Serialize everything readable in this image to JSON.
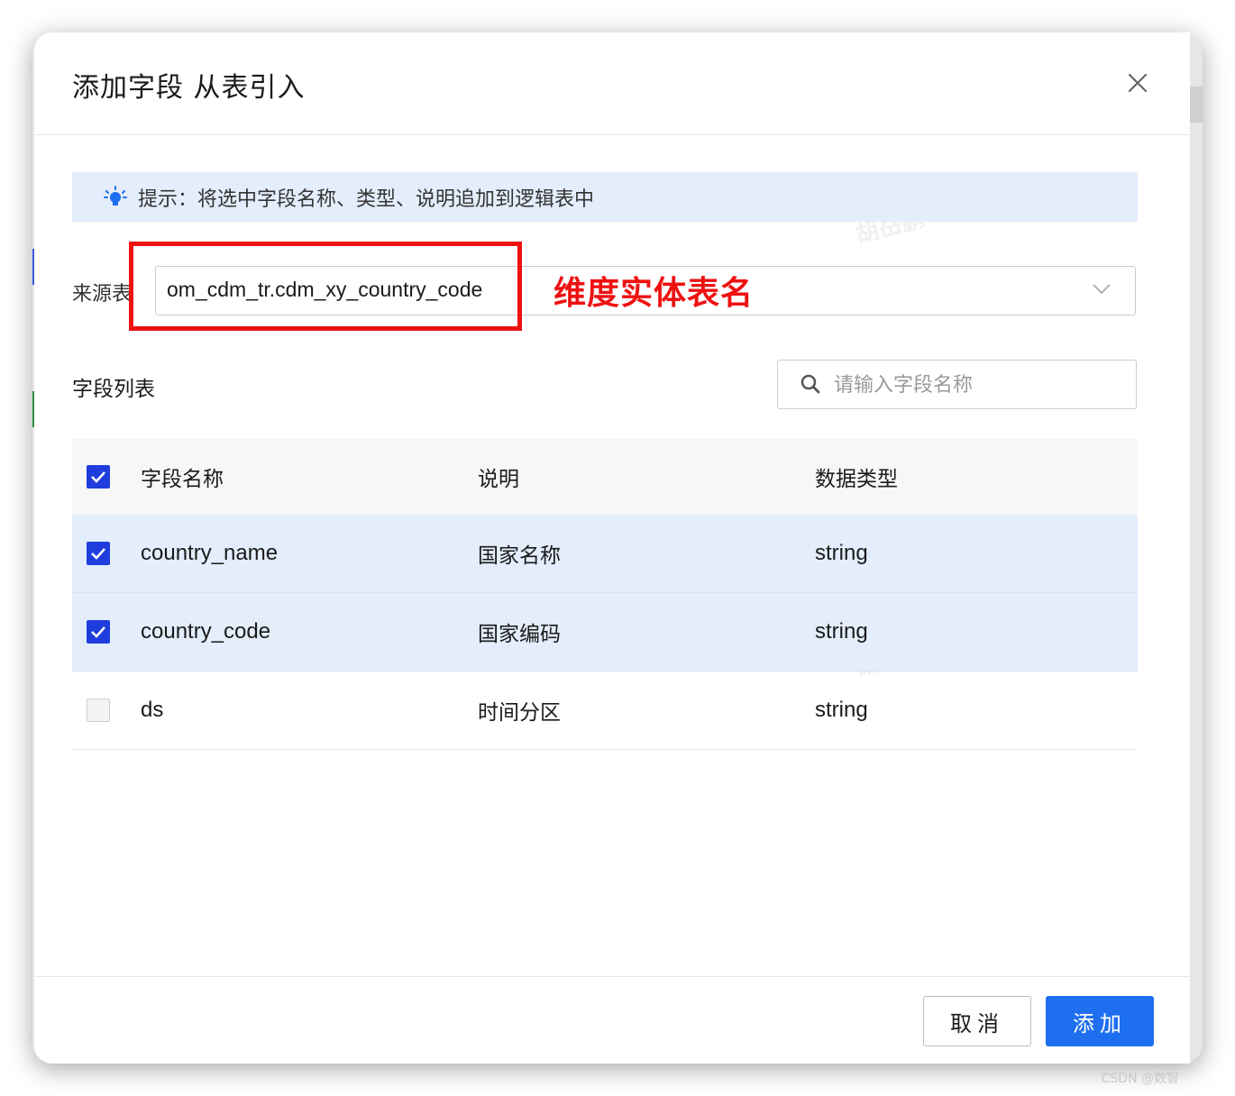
{
  "dialog": {
    "title": "添加字段 从表引入",
    "close_label": "×"
  },
  "tip": {
    "text": "提示：将选中字段名称、类型、说明追加到逻辑表中",
    "icon": "lightbulb-icon"
  },
  "source_table": {
    "label": "来源表",
    "value": "om_cdm_tr.cdm_xy_country_code",
    "annotation": "维度实体表名"
  },
  "field_list": {
    "label": "字段列表",
    "search_placeholder": "请输入字段名称"
  },
  "table": {
    "columns": [
      "字段名称",
      "说明",
      "数据类型"
    ],
    "header_checked": true,
    "rows": [
      {
        "name": "country_name",
        "desc": "国家名称",
        "type": "string",
        "checked": true
      },
      {
        "name": "country_code",
        "desc": "国家编码",
        "type": "string",
        "checked": true
      },
      {
        "name": "ds",
        "desc": "时间分区",
        "type": "string",
        "checked": false
      }
    ]
  },
  "footer": {
    "cancel_label": "取消",
    "add_label": "添加"
  },
  "colors": {
    "primary": "#1e6ff0",
    "checkbox": "#1e3ddc",
    "selected_row": "#e3edfb",
    "annotation_red": "#ee1111"
  },
  "credit": "CSDN @数智"
}
